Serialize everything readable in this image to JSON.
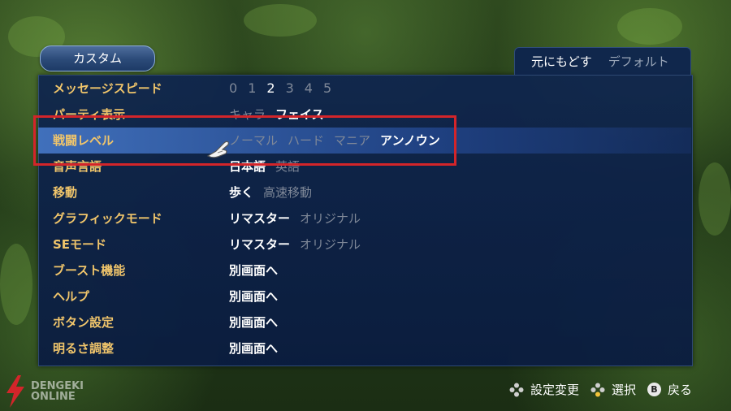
{
  "menu_title": "カスタム",
  "top_buttons": {
    "reset": "元にもどす",
    "default": "デフォルト"
  },
  "settings": [
    {
      "label": "メッセージスピード",
      "options": [
        "0",
        "1",
        "2",
        "3",
        "4",
        "5"
      ],
      "selected": "2"
    },
    {
      "label": "パーティ表示",
      "options": [
        "キャラ",
        "フェイス"
      ],
      "selected": "フェイス"
    },
    {
      "label": "戦闘レベル",
      "options": [
        "ノーマル",
        "ハード",
        "マニア",
        "アンノウン"
      ],
      "selected": "アンノウン"
    },
    {
      "label": "音声言語",
      "options": [
        "日本語",
        "英語"
      ],
      "selected": "日本語"
    },
    {
      "label": "移動",
      "options": [
        "歩く",
        "高速移動"
      ],
      "selected": "歩く"
    },
    {
      "label": "グラフィックモード",
      "options": [
        "リマスター",
        "オリジナル"
      ],
      "selected": "リマスター"
    },
    {
      "label": "SEモード",
      "options": [
        "リマスター",
        "オリジナル"
      ],
      "selected": "リマスター"
    },
    {
      "label": "ブースト機能",
      "options": [
        "別画面へ"
      ],
      "selected": "別画面へ"
    },
    {
      "label": "ヘルプ",
      "options": [
        "別画面へ"
      ],
      "selected": "別画面へ"
    },
    {
      "label": "ボタン設定",
      "options": [
        "別画面へ"
      ],
      "selected": "別画面へ"
    },
    {
      "label": "明るさ調整",
      "options": [
        "別画面へ"
      ],
      "selected": "別画面へ"
    }
  ],
  "footer": {
    "change": "設定変更",
    "select": "選択",
    "back_key": "B",
    "back": "戻る"
  },
  "watermark": {
    "line1": "DENGEKI",
    "line2": "ONLINE"
  },
  "colors": {
    "label": "#f0c56b",
    "highlight": "#d3252a",
    "panel": "#0e244e"
  }
}
